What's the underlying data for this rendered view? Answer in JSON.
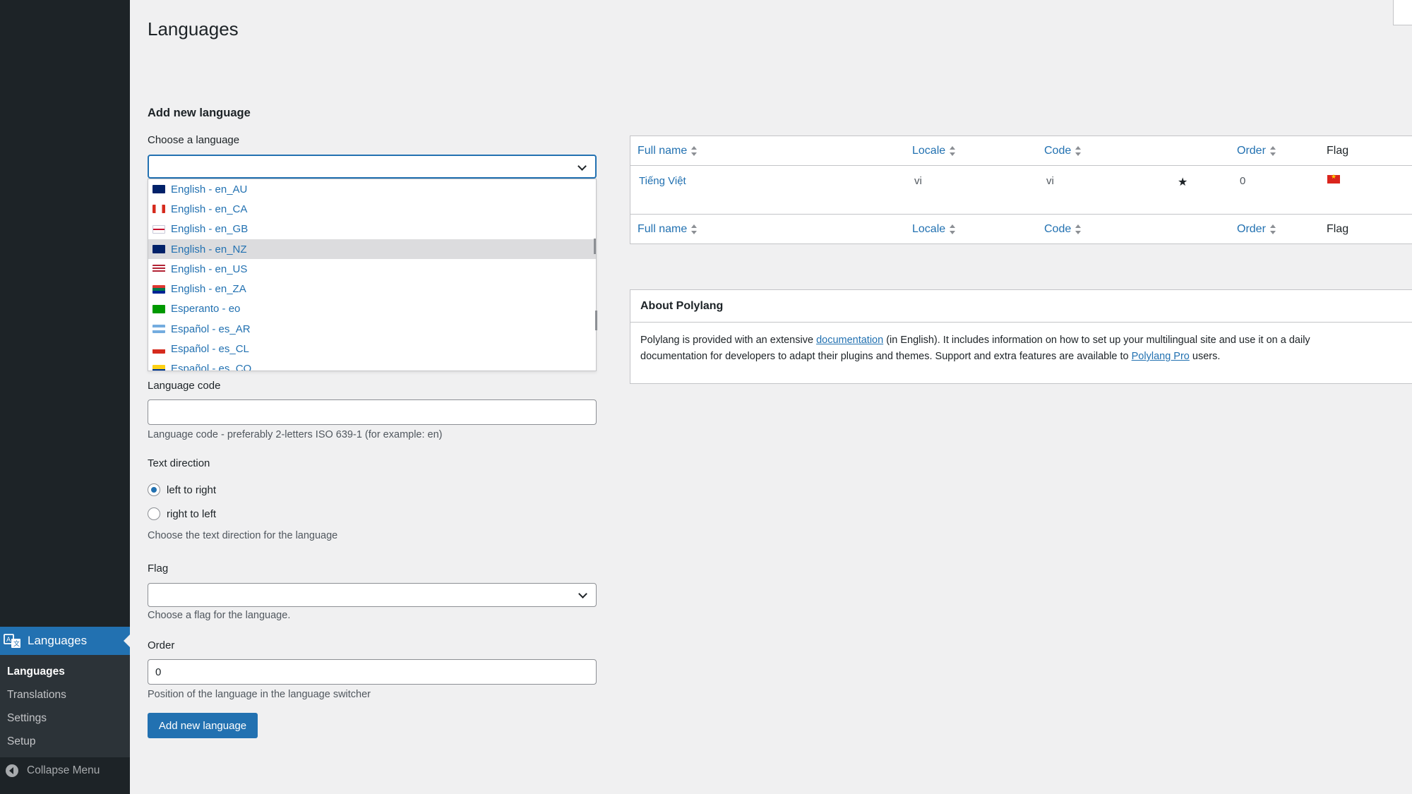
{
  "page_title": "Languages",
  "sidebar": {
    "active_menu": "Languages",
    "submenu": [
      "Languages",
      "Translations",
      "Settings",
      "Setup"
    ],
    "collapse_label": "Collapse Menu"
  },
  "form": {
    "heading": "Add new language",
    "choose_label": "Choose a language",
    "dropdown_options": [
      {
        "label": "English - en_AU",
        "flag": "au"
      },
      {
        "label": "English - en_CA",
        "flag": "ca"
      },
      {
        "label": "English - en_GB",
        "flag": "gb"
      },
      {
        "label": "English - en_NZ",
        "flag": "nz",
        "highlighted": true
      },
      {
        "label": "English - en_US",
        "flag": "us"
      },
      {
        "label": "English - en_ZA",
        "flag": "za"
      },
      {
        "label": "Esperanto - eo",
        "flag": "eo"
      },
      {
        "label": "Español - es_AR",
        "flag": "ar"
      },
      {
        "label": "Español - es_CL",
        "flag": "cl"
      },
      {
        "label": "Español - es_CO",
        "flag": "co"
      }
    ],
    "code_label": "Language code",
    "code_value": "",
    "code_desc": "Language code - preferably 2-letters ISO 639-1 (for example: en)",
    "direction_label": "Text direction",
    "direction_ltr": "left to right",
    "direction_rtl": "right to left",
    "direction_desc": "Choose the text direction for the language",
    "flag_label": "Flag",
    "flag_desc": "Choose a flag for the language.",
    "order_label": "Order",
    "order_value": "0",
    "order_desc": "Position of the language in the language switcher",
    "submit_label": "Add new language"
  },
  "table": {
    "headers": [
      "Full name",
      "Locale",
      "Code",
      "Order",
      "Flag"
    ],
    "rows": [
      {
        "full_name": "Tiếng Việt",
        "locale": "vi",
        "code": "vi",
        "default": true,
        "order": "0",
        "flag": "vn"
      }
    ]
  },
  "about": {
    "title": "About Polylang",
    "line1_a": "Polylang is provided with an extensive ",
    "line1_link": "documentation",
    "line1_b": " (in English). It includes information on how to set up your multilingual site and use it on a daily",
    "line2_a": "documentation for developers to adapt their plugins and themes. Support and extra features are available to ",
    "line2_link": "Polylang Pro",
    "line2_b": " users."
  },
  "colors": {
    "accent": "#2271b1",
    "sidebar_bg": "#1d2327",
    "page_bg": "#f0f0f1"
  }
}
